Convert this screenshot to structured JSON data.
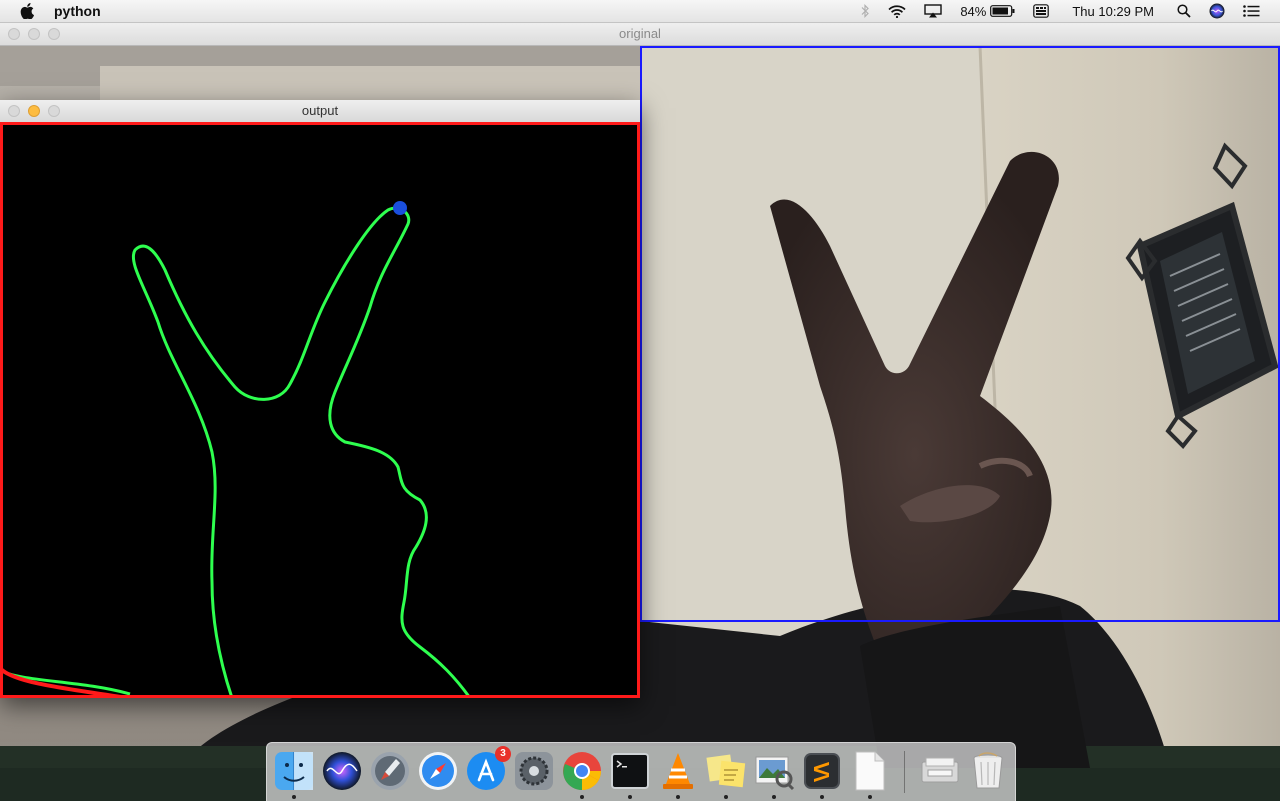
{
  "menubar": {
    "app_name": "python",
    "battery_percent": "84%",
    "clock": "Thu 10:29 PM",
    "icons": [
      "apple-icon",
      "bluetooth-icon",
      "wifi-icon",
      "airplay-icon",
      "battery-icon",
      "keyboard-input-icon",
      "spotlight-search-icon",
      "siri-icon",
      "notification-center-icon"
    ]
  },
  "windows": {
    "original": {
      "title": "original",
      "roi_box_color": "#1a1aff"
    },
    "output": {
      "title": "output",
      "contour_color": "#2eff4f",
      "fingertip_color": "#1a4fdd",
      "hull_color": "#ff1a1a"
    }
  },
  "dock": {
    "items": [
      {
        "name": "Finder",
        "icon": "finder-icon",
        "running": true
      },
      {
        "name": "Siri",
        "icon": "siri-icon",
        "running": false
      },
      {
        "name": "Launchpad",
        "icon": "launchpad-icon",
        "running": false
      },
      {
        "name": "Safari",
        "icon": "safari-icon",
        "running": false
      },
      {
        "name": "App Store",
        "icon": "app-store-icon",
        "running": false,
        "badge": "3"
      },
      {
        "name": "System Preferences",
        "icon": "system-preferences-icon",
        "running": false
      },
      {
        "name": "Google Chrome",
        "icon": "chrome-icon",
        "running": true
      },
      {
        "name": "Terminal",
        "icon": "terminal-icon",
        "running": true
      },
      {
        "name": "VLC",
        "icon": "vlc-icon",
        "running": true
      },
      {
        "name": "Stickies",
        "icon": "stickies-icon",
        "running": true
      },
      {
        "name": "Preview",
        "icon": "preview-icon",
        "running": true
      },
      {
        "name": "Sublime Text",
        "icon": "sublime-text-icon",
        "running": true
      },
      {
        "name": "Python",
        "icon": "document-icon",
        "running": true
      },
      {
        "name": "Downloads",
        "icon": "downloads-folder-icon",
        "running": false
      },
      {
        "name": "Trash",
        "icon": "trash-icon",
        "running": false
      }
    ]
  }
}
